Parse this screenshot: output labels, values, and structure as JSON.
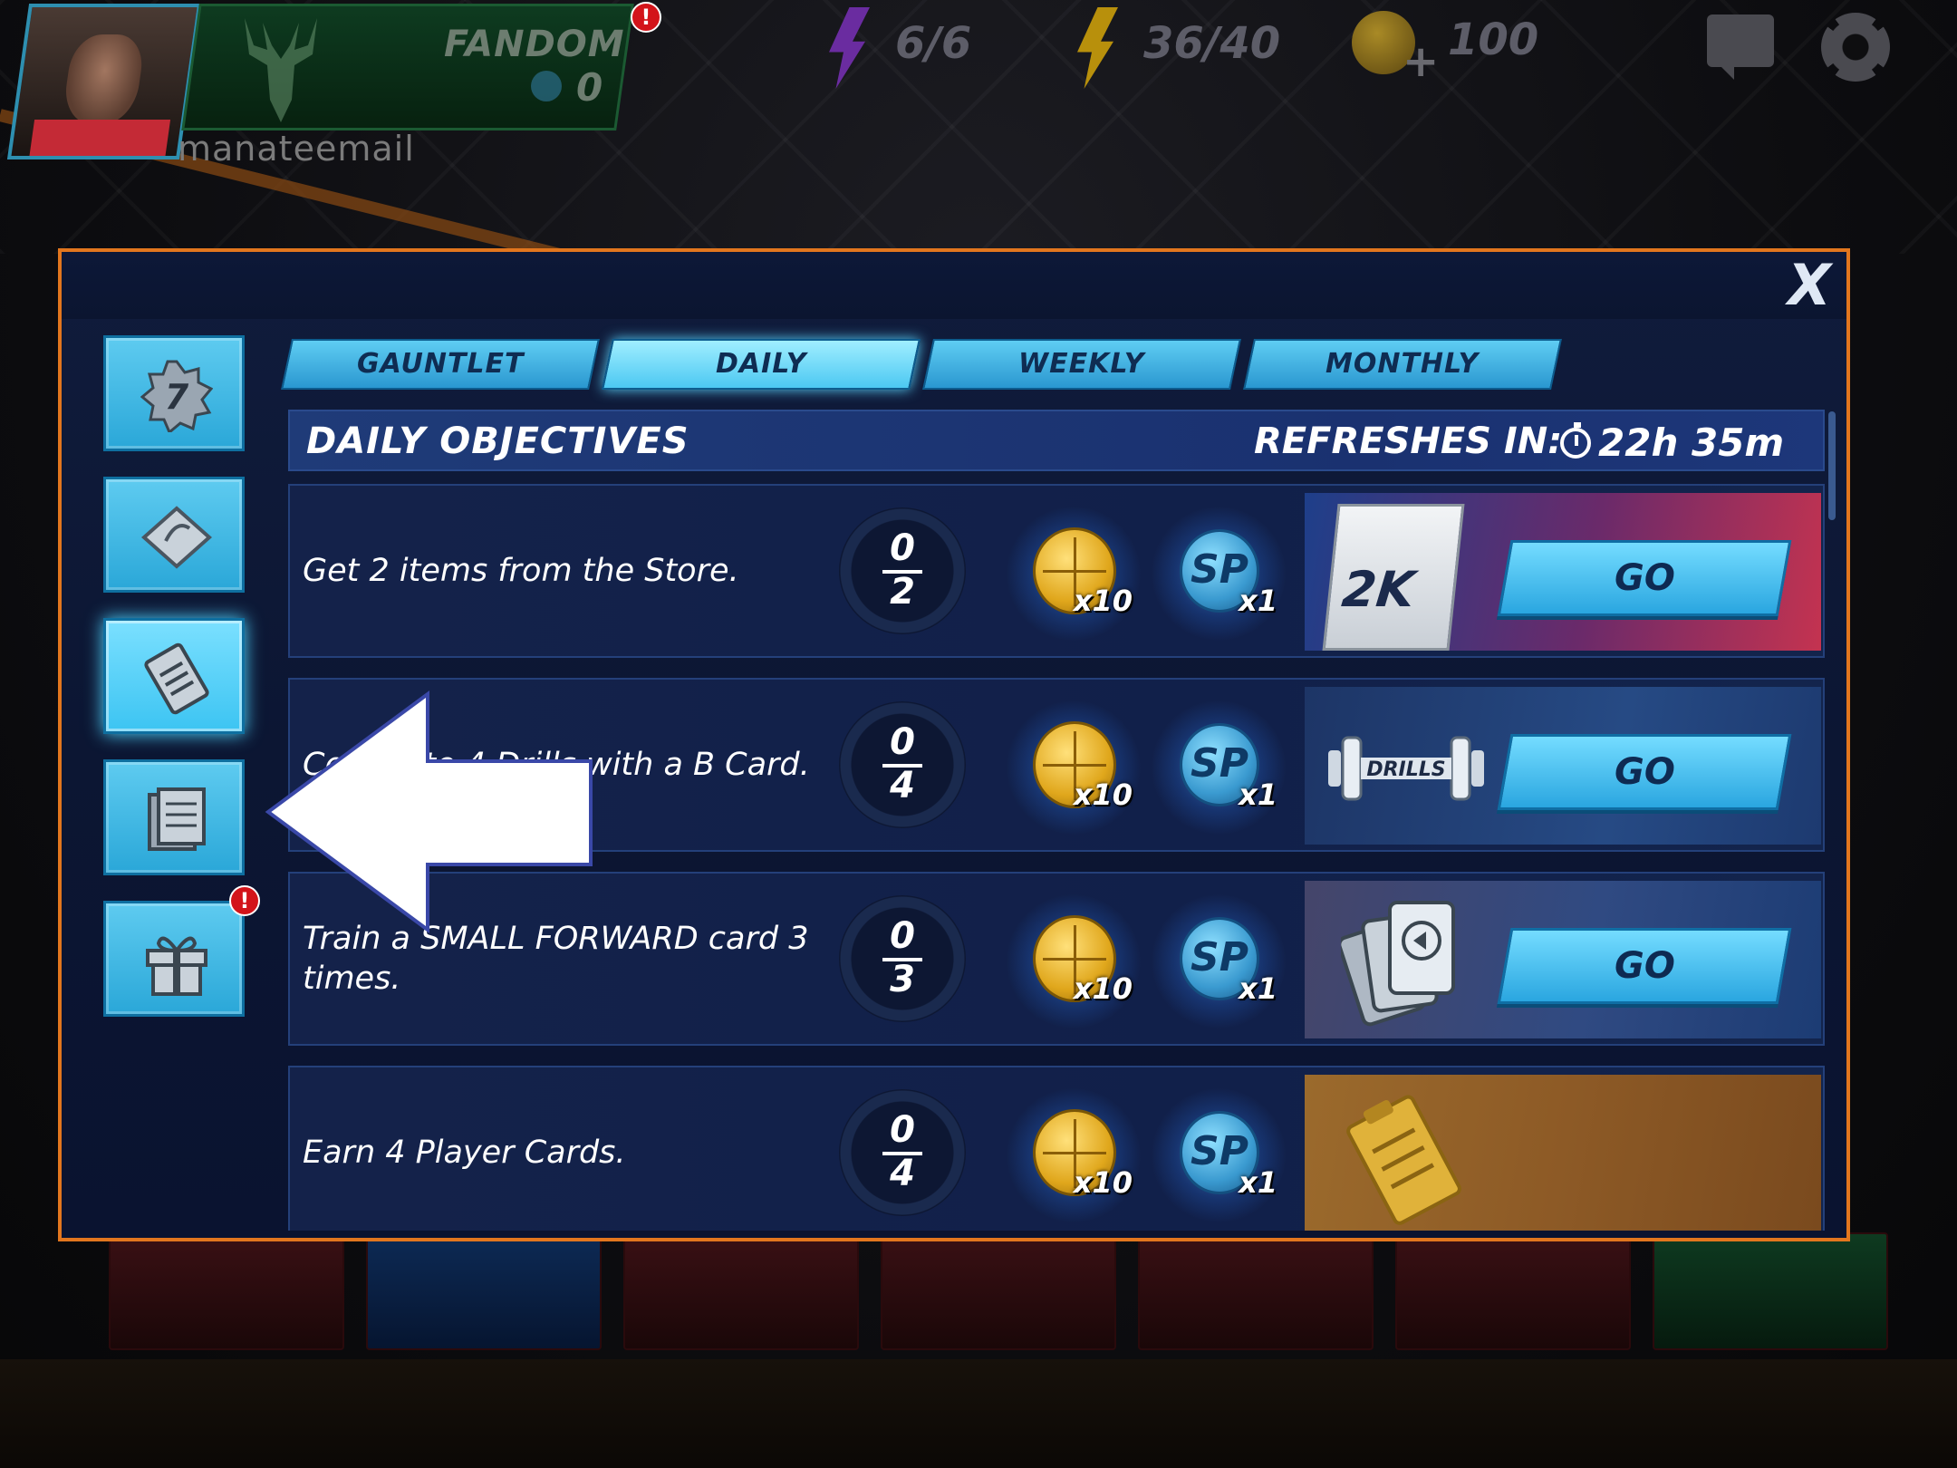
{
  "hud": {
    "fandom_label": "FANDOM",
    "fandom_count": "0",
    "fandom_alert": "!",
    "username": "manateemail",
    "energy_purple": "6/6",
    "energy_yellow": "36/40",
    "coins": "100",
    "icons": [
      "player-avatar",
      "bucks-logo-icon",
      "purple-bolt-icon",
      "yellow-bolt-icon",
      "coin-plus-icon",
      "chat-icon",
      "gear-icon"
    ]
  },
  "modal": {
    "close_label": "X",
    "side_menu": [
      {
        "icon": "badge-7-icon",
        "active": false
      },
      {
        "icon": "ticket-icon",
        "active": false
      },
      {
        "icon": "clipboard-icon",
        "active": true
      },
      {
        "icon": "news-icon",
        "active": false
      },
      {
        "icon": "gift-icon",
        "active": false,
        "badge": "!"
      }
    ],
    "tabs": [
      {
        "label": "GAUNTLET",
        "active": false
      },
      {
        "label": "DAILY",
        "active": true
      },
      {
        "label": "WEEKLY",
        "active": false
      },
      {
        "label": "MONTHLY",
        "active": false
      }
    ],
    "header": {
      "title": "DAILY OBJECTIVES",
      "refresh_label": "REFRESHES IN:",
      "refresh_value": "22h 35m"
    },
    "objectives": [
      {
        "text": "Get 2 items from the Store.",
        "progress_current": "0",
        "progress_total": "2",
        "coin_qty": "x10",
        "sp_qty": "x1",
        "panel": "store",
        "panel_text": "2K",
        "go_label": "GO"
      },
      {
        "text": "Complete 4 Drills with a B Card.",
        "progress_current": "0",
        "progress_total": "4",
        "coin_qty": "x10",
        "sp_qty": "x1",
        "panel": "drills",
        "panel_text": "DRILLS",
        "go_label": "GO"
      },
      {
        "text": "Train a SMALL FORWARD card 3 times.",
        "progress_current": "0",
        "progress_total": "3",
        "coin_qty": "x10",
        "sp_qty": "x1",
        "panel": "cards",
        "go_label": "GO"
      },
      {
        "text": "Earn 4 Player Cards.",
        "progress_current": "0",
        "progress_total": "4",
        "coin_qty": "x10",
        "sp_qty": "x1",
        "panel": "player"
      }
    ],
    "sp_token_label": "SP"
  },
  "colors": {
    "modal_border": "#e2761e",
    "tab_blue": "#4cc8f2",
    "go_blue": "#2aa6e0",
    "alert_red": "#d3141a"
  }
}
